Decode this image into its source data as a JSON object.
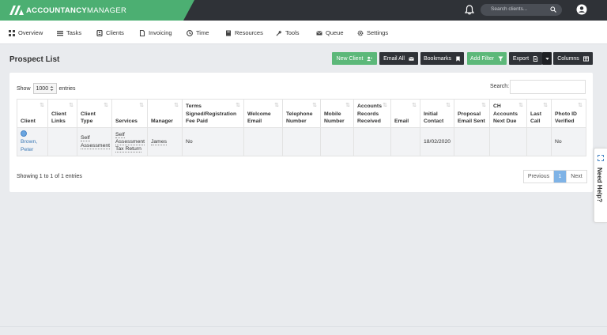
{
  "brand": {
    "bold": "ACCOUNTANCY",
    "regular": "MANAGER",
    "color": "#4caf72"
  },
  "topbar": {
    "search_placeholder": "Search clients...",
    "icons": [
      "bell-icon",
      "search-icon",
      "user-icon"
    ]
  },
  "nav": [
    {
      "label": "Overview",
      "icon": "grid-icon"
    },
    {
      "label": "Tasks",
      "icon": "list-icon"
    },
    {
      "label": "Clients",
      "icon": "clients-icon"
    },
    {
      "label": "Invoicing",
      "icon": "document-icon"
    },
    {
      "label": "Time",
      "icon": "clock-icon"
    },
    {
      "label": "Resources",
      "icon": "book-icon"
    },
    {
      "label": "Tools",
      "icon": "wrench-icon"
    },
    {
      "label": "Queue",
      "icon": "envelope-icon"
    },
    {
      "label": "Settings",
      "icon": "gear-icon"
    }
  ],
  "page_title": "Prospect List",
  "buttons": {
    "new_client": "New Client",
    "email_all": "Email All",
    "bookmarks": "Bookmarks",
    "add_filter": "Add Filter",
    "export": "Export",
    "columns": "Columns"
  },
  "table_controls": {
    "show": "Show",
    "entries_value": "1000",
    "entries": "entries",
    "search_label": "Search:"
  },
  "columns": [
    "Client",
    "Client Links",
    "Client Type",
    "Services",
    "Manager",
    "Terms Signed/Registration Fee Paid",
    "Welcome Email",
    "Telephone Number",
    "Mobile Number",
    "Accounts Records Received",
    "Email",
    "Initial Contact",
    "Proposal Email Sent",
    "CH Accounts Next Due",
    "Last Call",
    "Photo ID Verified"
  ],
  "rows": [
    {
      "client": "Brown, Peter",
      "client_links": "",
      "client_type": "Self Assessment",
      "services": "Self Assessment Tax Return",
      "manager": "James",
      "terms": "No",
      "welcome_email": "",
      "telephone": "",
      "mobile": "",
      "accounts_records": "",
      "email": "",
      "initial_contact": "18/02/2020",
      "proposal_email": "",
      "ch_accounts": "",
      "last_call": "",
      "photo_id": "No"
    }
  ],
  "footer_info": "Showing 1 to 1 of 1 entries",
  "pager": {
    "previous": "Previous",
    "current": "1",
    "next": "Next"
  },
  "help_tab": "Need Help?"
}
